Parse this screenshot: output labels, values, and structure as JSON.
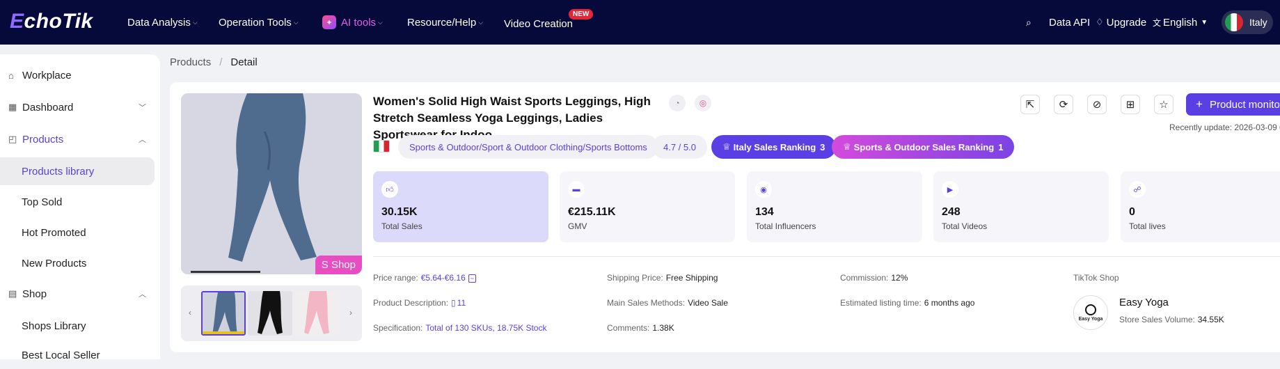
{
  "header": {
    "logo": "EchoTik",
    "nav": [
      {
        "label": "Data Analysis"
      },
      {
        "label": "Operation Tools"
      },
      {
        "label": "AI tools"
      },
      {
        "label": "Resource/Help"
      },
      {
        "label": "Video Creation"
      }
    ],
    "new_badge": "NEW",
    "data_api": "Data API",
    "upgrade": "Upgrade",
    "language": "English",
    "region": "Italy"
  },
  "sidebar": {
    "workplace": "Workplace",
    "dashboard": "Dashboard",
    "products": "Products",
    "products_items": [
      "Products library",
      "Top Sold",
      "Hot Promoted",
      "New Products"
    ],
    "shop": "Shop",
    "shop_items": [
      "Shops Library",
      "Best Local Seller"
    ]
  },
  "breadcrumb": {
    "root": "Products",
    "sep": "/",
    "current": "Detail"
  },
  "product": {
    "title": "Women's Solid High Waist Sports Leggings, High Stretch Seamless Yoga Leggings, Ladies Sportswear for Indoo...",
    "category": "Sports & Outdoor/Sport & Outdoor Clothing/Sports Bottoms",
    "rating": "4.7 / 5.0",
    "rank1_label": "Italy Sales Ranking",
    "rank1_value": "3",
    "rank2_label": "Sports & Outdoor Sales Ranking",
    "rank2_value": "1",
    "shop_badge": "S Shop",
    "monitor_button": "Product monito",
    "recently_update": "Recently update: 2026-03-09 0"
  },
  "metrics": [
    {
      "value": "30.15K",
      "label": "Total Sales"
    },
    {
      "value": "€215.11K",
      "label": "GMV"
    },
    {
      "value": "134",
      "label": "Total Influencers"
    },
    {
      "value": "248",
      "label": "Total Videos"
    },
    {
      "value": "0",
      "label": "Total lives"
    }
  ],
  "info": {
    "price_label": "Price range:",
    "price_value": "€5.64-€6.16",
    "desc_label": "Product Description:",
    "desc_value": "11",
    "spec_label": "Specification:",
    "spec_value": "Total of 130 SKUs, 18.75K Stock",
    "shipping_label": "Shipping Price:",
    "shipping_value": "Free Shipping",
    "methods_label": "Main Sales Methods:",
    "methods_value": "Video Sale",
    "comments_label": "Comments:",
    "comments_value": "1.38K",
    "commission_label": "Commission:",
    "commission_value": "12%",
    "listing_label": "Estimated listing time:",
    "listing_value": "6 months ago"
  },
  "shop": {
    "section_label": "TikTok Shop",
    "name": "Easy Yoga",
    "logo_text": "Easy Yoga",
    "volume_label": "Store Sales Volume:",
    "volume_value": "34.55K"
  },
  "colors": {
    "header_bg": "#060a3a",
    "accent": "#5a3fe4",
    "pink": "#e84dc1"
  }
}
